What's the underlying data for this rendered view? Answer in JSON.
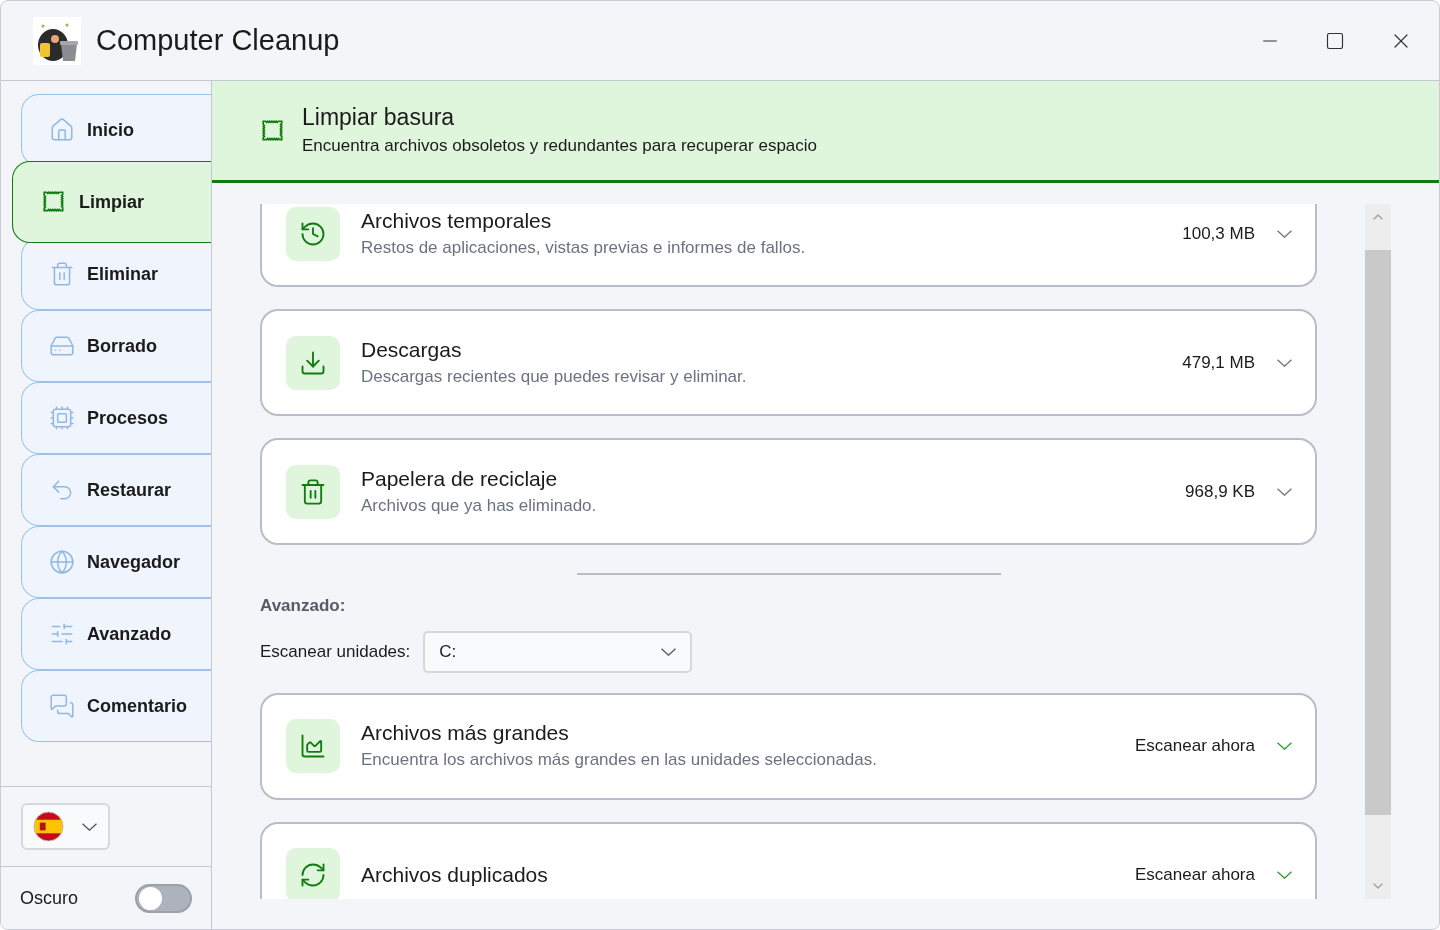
{
  "window": {
    "title": "Computer Cleanup"
  },
  "sidebar": {
    "items": [
      {
        "label": "Inicio",
        "selected": false
      },
      {
        "label": "Limpiar",
        "selected": true
      },
      {
        "label": "Eliminar",
        "selected": false
      },
      {
        "label": "Borrado",
        "selected": false
      },
      {
        "label": "Procesos",
        "selected": false
      },
      {
        "label": "Restaurar",
        "selected": false
      },
      {
        "label": "Navegador",
        "selected": false
      },
      {
        "label": "Avanzado",
        "selected": false
      },
      {
        "label": "Comentario",
        "selected": false
      }
    ],
    "dark_mode": {
      "label": "Oscuro",
      "on": false
    }
  },
  "header": {
    "title": "Limpiar basura",
    "subtitle": "Encuentra archivos obsoletos y redundantes para recuperar espacio"
  },
  "items": [
    {
      "kind": "size",
      "title": "Archivos temporales",
      "description": "Restos de aplicaciones, vistas previas e informes de fallos.",
      "value": "100,3 MB"
    },
    {
      "kind": "size",
      "title": "Descargas",
      "description": "Descargas recientes que puedes revisar y eliminar.",
      "value": "479,1 MB"
    },
    {
      "kind": "size",
      "title": "Papelera de reciclaje",
      "description": "Archivos que ya has eliminado.",
      "value": "968,9 KB"
    }
  ],
  "advanced": {
    "heading": "Avanzado:",
    "drive_label": "Escanear unidades:",
    "drive_value": "C:"
  },
  "advanced_items": [
    {
      "kind": "action",
      "title": "Archivos más grandes",
      "description": "Encuentra los archivos más grandes en las unidades seleccionadas.",
      "value": "Escanear ahora"
    },
    {
      "kind": "action",
      "title": "Archivos duplicados",
      "value": "Escanear ahora"
    }
  ]
}
